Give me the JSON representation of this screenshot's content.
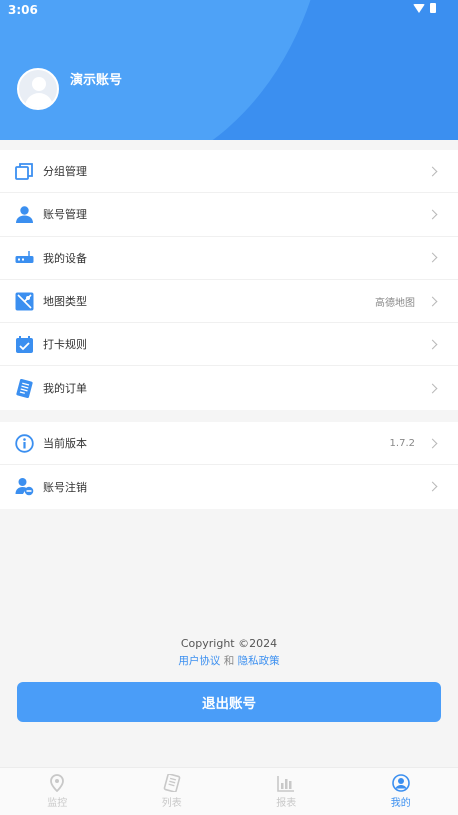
{
  "status_bar": {
    "time": "3:06"
  },
  "profile": {
    "name": "演示账号"
  },
  "menu": [
    {
      "label": "分组管理",
      "value": ""
    },
    {
      "label": "账号管理",
      "value": ""
    },
    {
      "label": "我的设备",
      "value": ""
    },
    {
      "label": "地图类型",
      "value": "高德地图"
    },
    {
      "label": "打卡规则",
      "value": ""
    },
    {
      "label": "我的订单",
      "value": ""
    }
  ],
  "menu2": [
    {
      "label": "当前版本",
      "value": "1.7.2"
    },
    {
      "label": "账号注销",
      "value": ""
    }
  ],
  "footer": {
    "copyright": "Copyright ©2024",
    "user_agreement": "用户协议",
    "and": "和",
    "privacy_policy": "隐私政策"
  },
  "logout_label": "退出账号",
  "tabs": [
    {
      "label": "监控"
    },
    {
      "label": "列表"
    },
    {
      "label": "报表"
    },
    {
      "label": "我的"
    }
  ],
  "colors": {
    "accent": "#3b8ff0",
    "header": "#3b8ff0",
    "button": "#4a9df8"
  }
}
